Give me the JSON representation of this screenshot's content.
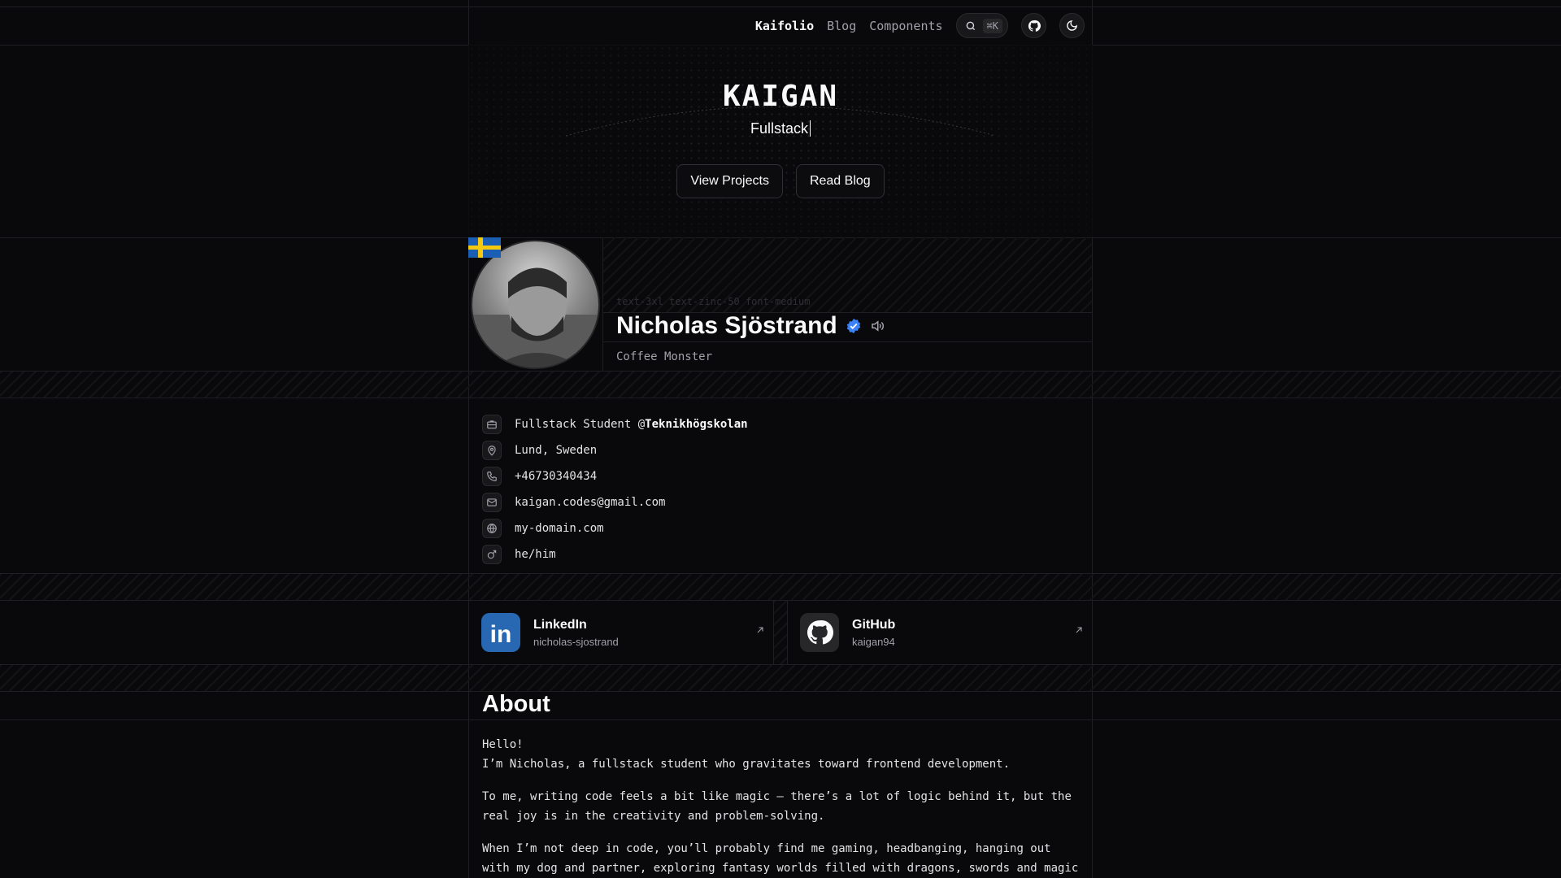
{
  "nav": {
    "items": [
      {
        "label": "Kaifolio",
        "active": true
      },
      {
        "label": "Blog",
        "active": false
      },
      {
        "label": "Components",
        "active": false
      }
    ],
    "search_shortcut": "⌘K"
  },
  "hero": {
    "logo_text": "KAIGAN",
    "tagline": "Fullstack",
    "buttons": [
      "View Projects",
      "Read Blog"
    ]
  },
  "profile": {
    "ghost_text": "text-3xl text-zinc-50 font-medium",
    "name": "Nicholas Sjöstrand",
    "subtitle": "Coffee Monster",
    "verified": true,
    "flag": "sweden"
  },
  "info": {
    "job_prefix": "Fullstack Student @",
    "job_company": "Teknikhögskolan",
    "location": "Lund, Sweden",
    "phone": "+46730340434",
    "email": "kaigan.codes@gmail.com",
    "website": "my-domain.com",
    "pronouns": "he/him"
  },
  "socials": [
    {
      "title": "LinkedIn",
      "handle": "nicholas-sjostrand",
      "icon": "linkedin-icon",
      "color": "#2867b2"
    },
    {
      "title": "GitHub",
      "handle": "kaigan94",
      "icon": "github-icon",
      "color": "#27272a"
    }
  ],
  "about": {
    "heading": "About",
    "p1_line1": "Hello!",
    "p1_line2": "I’m Nicholas, a fullstack student who gravitates toward frontend development.",
    "p2": "To me, writing code feels a bit like magic – there’s a lot of logic behind it, but the real joy is in the creativity and problem-solving.",
    "p3": "When I’m not deep in code, you’ll probably find me gaming, headbanging, hanging out with my dog and partner, exploring fantasy worlds filled with dragons, swords and magic"
  },
  "colors": {
    "background": "#09090b",
    "border": "#1f1f23",
    "verified": "#3b82f6"
  }
}
